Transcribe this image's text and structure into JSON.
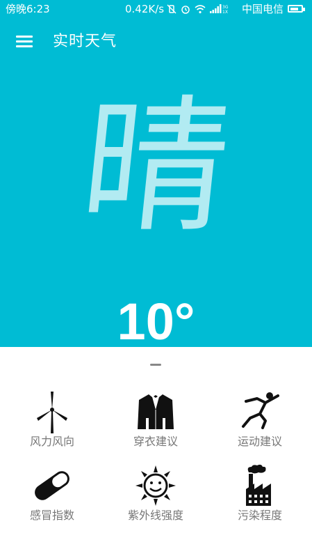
{
  "status_bar": {
    "time": "傍晚6:23",
    "network_speed": "0.42K/s",
    "carrier": "中国电信",
    "network_type": "3G 1X",
    "battery_level": 0.75,
    "icons": [
      "vibrate-off-icon",
      "alarm-icon",
      "wifi-icon",
      "signal-icon"
    ]
  },
  "header": {
    "menu_icon": "hamburger-menu-icon",
    "title": "实时天气"
  },
  "weather": {
    "condition": "晴",
    "temperature": "10°"
  },
  "colors": {
    "primary": "#00BCD4",
    "glyph": "#B2EBF2",
    "label": "#777777"
  },
  "features": [
    {
      "label": "风力风向",
      "icon": "wind-turbine-icon"
    },
    {
      "label": "穿衣建议",
      "icon": "suit-icon"
    },
    {
      "label": "运动建议",
      "icon": "runner-icon"
    },
    {
      "label": "感冒指数",
      "icon": "pill-icon"
    },
    {
      "label": "紫外线强度",
      "icon": "sun-icon"
    },
    {
      "label": "污染程度",
      "icon": "factory-icon"
    }
  ]
}
